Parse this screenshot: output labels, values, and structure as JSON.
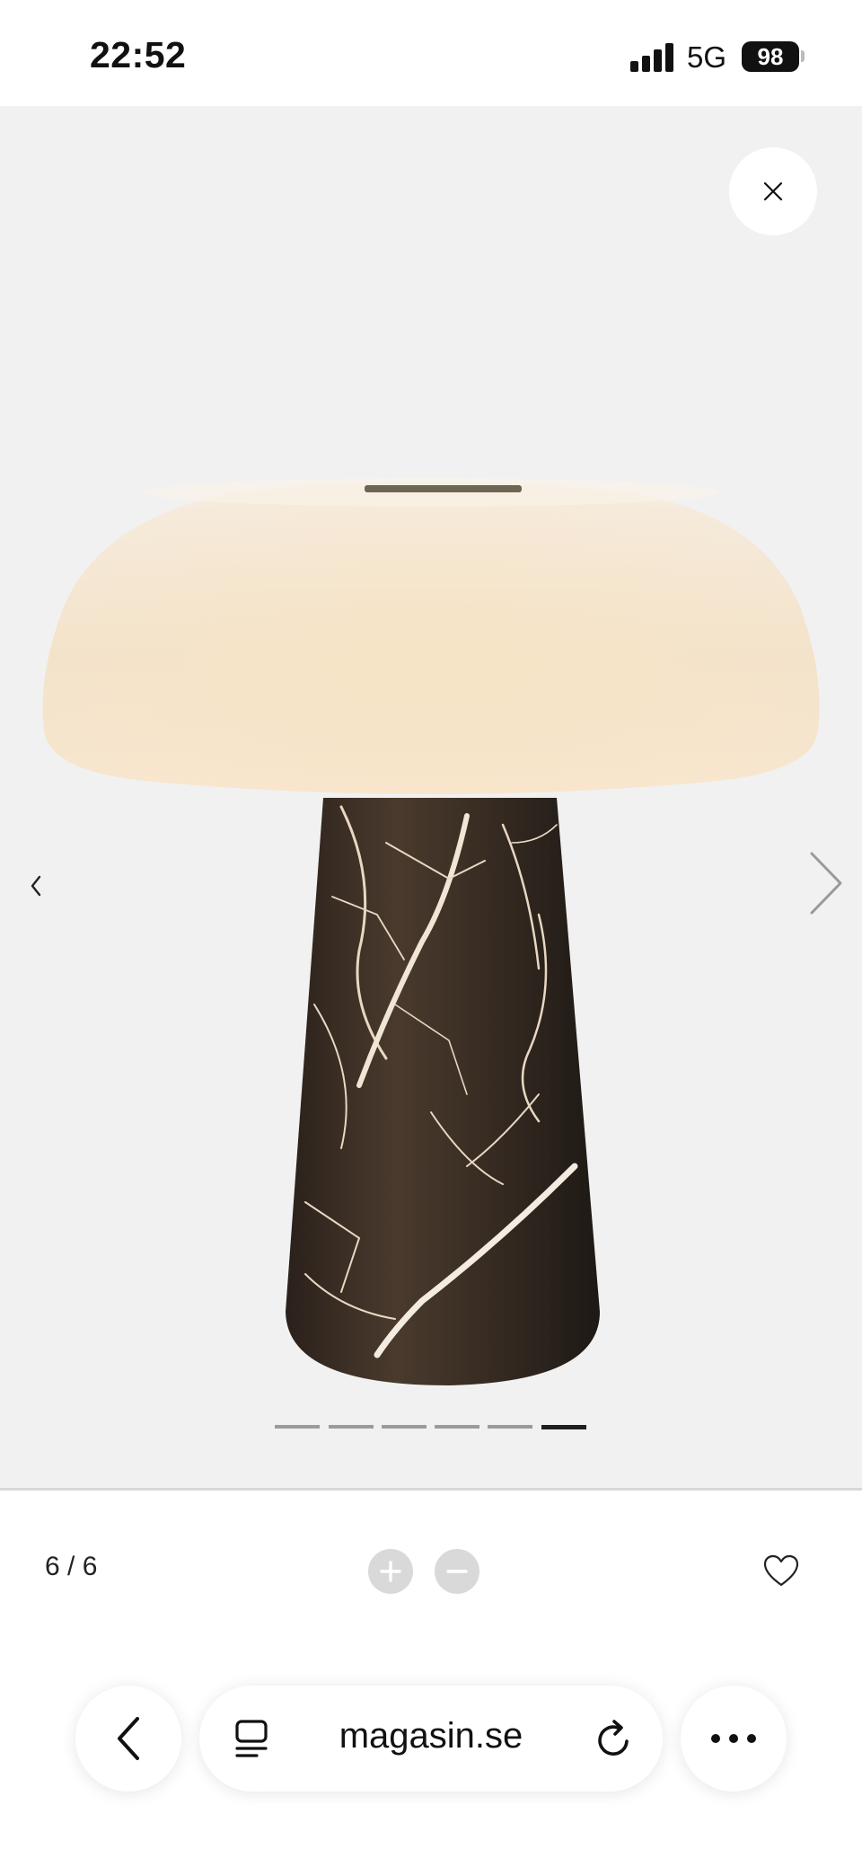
{
  "status_bar": {
    "time": "22:52",
    "network": "5G",
    "battery": "98"
  },
  "gallery": {
    "image_alt": "Table lamp with white mushroom-shaped shade and dark marble base",
    "slide_count": 6,
    "active_slide": 6
  },
  "controls": {
    "counter": "6 / 6"
  },
  "browser": {
    "url": "magasin.se"
  },
  "icons": {
    "close": "close-icon",
    "prev": "chevron-left-icon",
    "next": "chevron-right-icon",
    "zoom_in": "plus-icon",
    "zoom_out": "minus-icon",
    "favorite": "heart-icon",
    "back": "back-arrow-icon",
    "reader": "reader-mode-icon",
    "reload": "reload-icon",
    "more": "more-dots-icon"
  },
  "colors": {
    "gallery_bg": "#f1f1f1",
    "active_dot": "#1f1f1f",
    "inactive_dot": "#9b9b9b"
  }
}
